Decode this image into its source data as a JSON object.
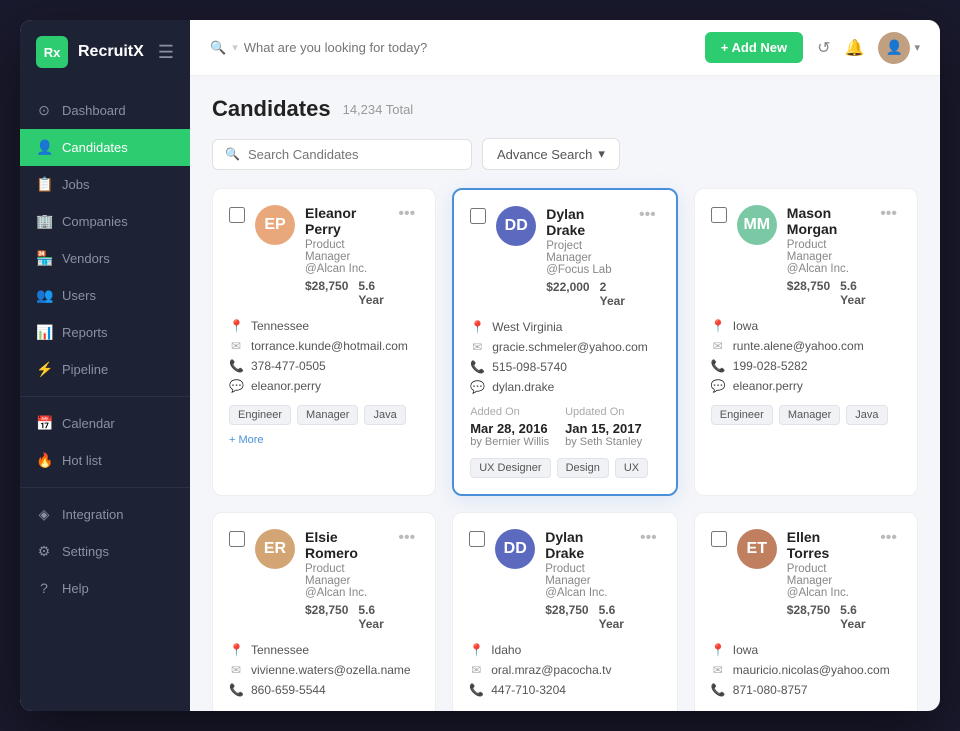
{
  "app": {
    "logo_abbr": "Rx",
    "logo_name": "RecruitX"
  },
  "sidebar": {
    "items": [
      {
        "label": "Dashboard",
        "icon": "⊙",
        "active": false
      },
      {
        "label": "Candidates",
        "icon": "👤",
        "active": true
      },
      {
        "label": "Jobs",
        "icon": "📋",
        "active": false
      },
      {
        "label": "Companies",
        "icon": "🏢",
        "active": false
      },
      {
        "label": "Vendors",
        "icon": "🏪",
        "active": false
      },
      {
        "label": "Users",
        "icon": "👥",
        "active": false
      },
      {
        "label": "Reports",
        "icon": "📊",
        "active": false
      },
      {
        "label": "Pipeline",
        "icon": "⚡",
        "active": false
      }
    ],
    "items2": [
      {
        "label": "Calendar",
        "icon": "📅"
      },
      {
        "label": "Hot list",
        "icon": "🔥"
      }
    ],
    "items3": [
      {
        "label": "Integration",
        "icon": "◈"
      },
      {
        "label": "Settings",
        "icon": "⚙"
      },
      {
        "label": "Help",
        "icon": "?"
      }
    ]
  },
  "topbar": {
    "search_placeholder": "What are you looking for today?",
    "add_new_label": "+ Add New"
  },
  "page": {
    "title": "Candidates",
    "total": "14,234 Total",
    "search_placeholder": "Search Candidates",
    "advance_search": "Advance Search"
  },
  "candidates": [
    {
      "id": 1,
      "name": "Eleanor Perry",
      "role": "Product Manager @Alcan Inc.",
      "salary": "$28,750",
      "experience": "5.6 Year",
      "location": "Tennessee",
      "email": "torrance.kunde@hotmail.com",
      "phone": "378-477-0505",
      "username": "eleanor.perry",
      "tags": [
        "Engineer",
        "Manager",
        "Java",
        "+ More"
      ],
      "active": false,
      "avatar_color": "#e8a87c",
      "initials": "EP"
    },
    {
      "id": 2,
      "name": "Dylan Drake",
      "role": "Project Manager @Focus Lab",
      "salary": "$22,000",
      "experience": "2 Year",
      "location": "West Virginia",
      "email": "gracie.schmeler@yahoo.com",
      "phone": "515-098-5740",
      "username": "dylan.drake",
      "tags": [
        "UX Designer",
        "Design",
        "UX"
      ],
      "active": true,
      "added_on": "Mar 28, 2016",
      "updated_on": "Jan 15, 2017",
      "added_by": "by Bernier Willis",
      "updated_by": "by Seth Stanley",
      "avatar_color": "#5b6abf",
      "initials": "DD"
    },
    {
      "id": 3,
      "name": "Mason Morgan",
      "role": "Product Manager @Alcan Inc.",
      "salary": "$28,750",
      "experience": "5.6 Year",
      "location": "Iowa",
      "email": "runte.alene@yahoo.com",
      "phone": "199-028-5282",
      "username": "eleanor.perry",
      "tags": [
        "Engineer",
        "Manager",
        "Java"
      ],
      "active": false,
      "avatar_color": "#7bc8a4",
      "initials": "MM"
    },
    {
      "id": 4,
      "name": "Elsie Romero",
      "role": "Product Manager @Alcan Inc.",
      "salary": "$28,750",
      "experience": "5.6 Year",
      "location": "Tennessee",
      "email": "vivienne.waters@ozella.name",
      "phone": "860-659-5544",
      "username": "",
      "tags": [],
      "active": false,
      "avatar_color": "#d4a574",
      "initials": "ER"
    },
    {
      "id": 5,
      "name": "Dylan Drake",
      "role": "Product Manager @Alcan Inc.",
      "salary": "$28,750",
      "experience": "5.6 Year",
      "location": "Idaho",
      "email": "oral.mraz@pacocha.tv",
      "phone": "447-710-3204",
      "username": "",
      "tags": [],
      "active": false,
      "avatar_color": "#5b6abf",
      "initials": "DD"
    },
    {
      "id": 6,
      "name": "Ellen Torres",
      "role": "Product Manager @Alcan Inc.",
      "salary": "$28,750",
      "experience": "5.6 Year",
      "location": "Iowa",
      "email": "mauricio.nicolas@yahoo.com",
      "phone": "871-080-8757",
      "username": "",
      "tags": [],
      "active": false,
      "avatar_color": "#c08060",
      "initials": "ET"
    }
  ]
}
